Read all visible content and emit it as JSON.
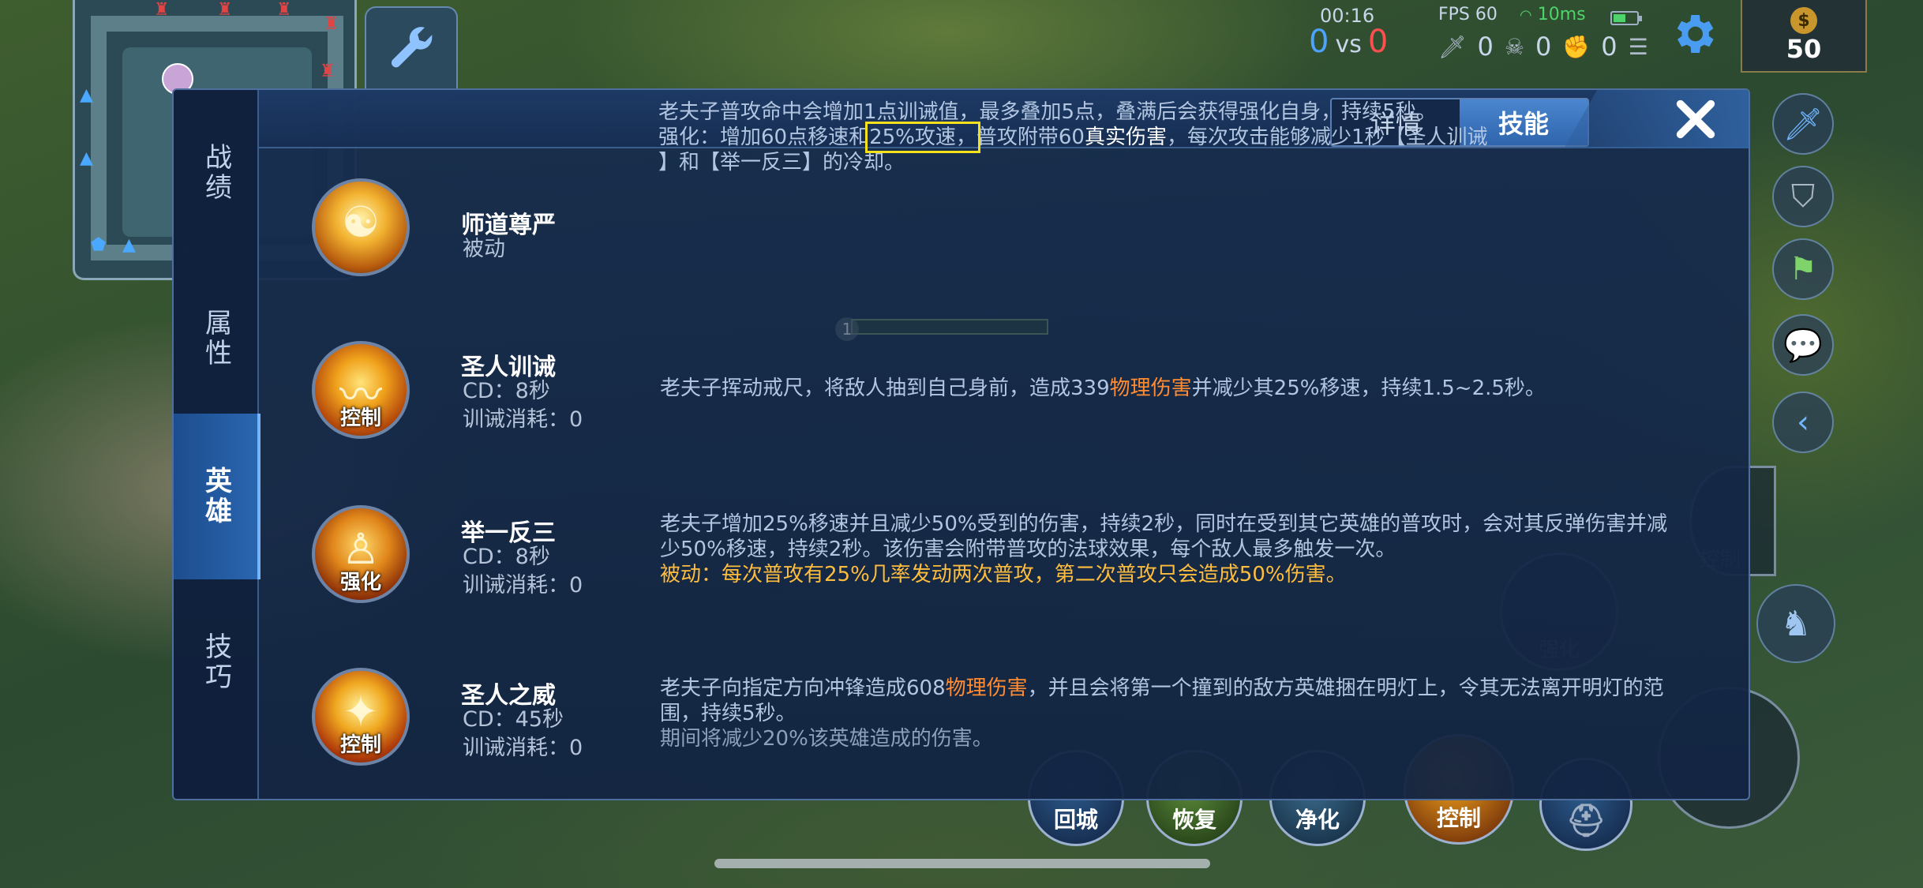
{
  "hud": {
    "time": "00:16",
    "score_blue": "0",
    "score_vs": "vs",
    "score_red": "0",
    "fps": "FPS 60",
    "ping": "10ms",
    "battery_level": 0.55,
    "kills": "0",
    "deaths": "0",
    "assists": "0",
    "gold": "50",
    "gold_icon": "$"
  },
  "panel": {
    "left_tabs": [
      "战绩",
      "属性",
      "英雄",
      "技巧"
    ],
    "left_active_index": 2,
    "top_tabs": [
      "详情",
      "技能"
    ],
    "top_active_index": 1,
    "close_icon": "close-icon"
  },
  "skills": [
    {
      "name": "师道尊严",
      "meta1": "被动",
      "meta2": "",
      "tag": "",
      "desc_line1": "老夫子普攻命中会增加1点训诫值，最多叠加5点，叠满后会获得强化自身，持续5秒。",
      "desc_l2_a": "强化：增加60点移速和",
      "desc_l2_box": "25%攻速，",
      "desc_l2_b": "普攻附带60",
      "desc_l2_white": "真实伤害",
      "desc_l2_c": "，每次攻击能够减少1秒【圣人训诫",
      "desc_line3": "】和【举一反三】的冷却。"
    },
    {
      "name": "圣人训诫",
      "meta1": "CD：8秒",
      "meta2": "训诫消耗：0",
      "tag": "控制",
      "desc_a": "老夫子挥动戒尺，将敌人抽到自己身前，造成339",
      "desc_orange": "物理伤害",
      "desc_b": "并减少其25%移速，持续1.5~2.5秒。"
    },
    {
      "name": "举一反三",
      "meta1": "CD：8秒",
      "meta2": "训诫消耗：0",
      "tag": "强化",
      "desc_line1": "老夫子增加25%移速并且减少50%受到的伤害，持续2秒，同时在受到其它英雄的普攻时，会对其反弹伤害并减",
      "desc_line2": "少50%移速，持续2秒。该伤害会附带普攻的法球效果，每个敌人最多触发一次。",
      "desc_line3": "被动：每次普攻有25%几率发动两次普攻，第二次普攻只会造成50%伤害。"
    },
    {
      "name": "圣人之威",
      "meta1": "CD：45秒",
      "meta2": "训诫消耗：0",
      "tag": "控制",
      "desc_a": "老夫子向指定方向冲锋造成608",
      "desc_orange": "物理伤害",
      "desc_b": "，并且会将第一个撞到的敌方英雄捆在明灯上，令其无法离开明灯的范",
      "desc_line2": "围，持续5秒。",
      "desc_line3": "期间将减少20%该英雄造成的伤害。"
    }
  ],
  "bottom_skills": [
    "回城",
    "恢复",
    "净化",
    "控制"
  ],
  "background_labels": {
    "ghost_skill_right": "控制",
    "ghost_skill_mid": "强化",
    "hero_level": "1"
  }
}
